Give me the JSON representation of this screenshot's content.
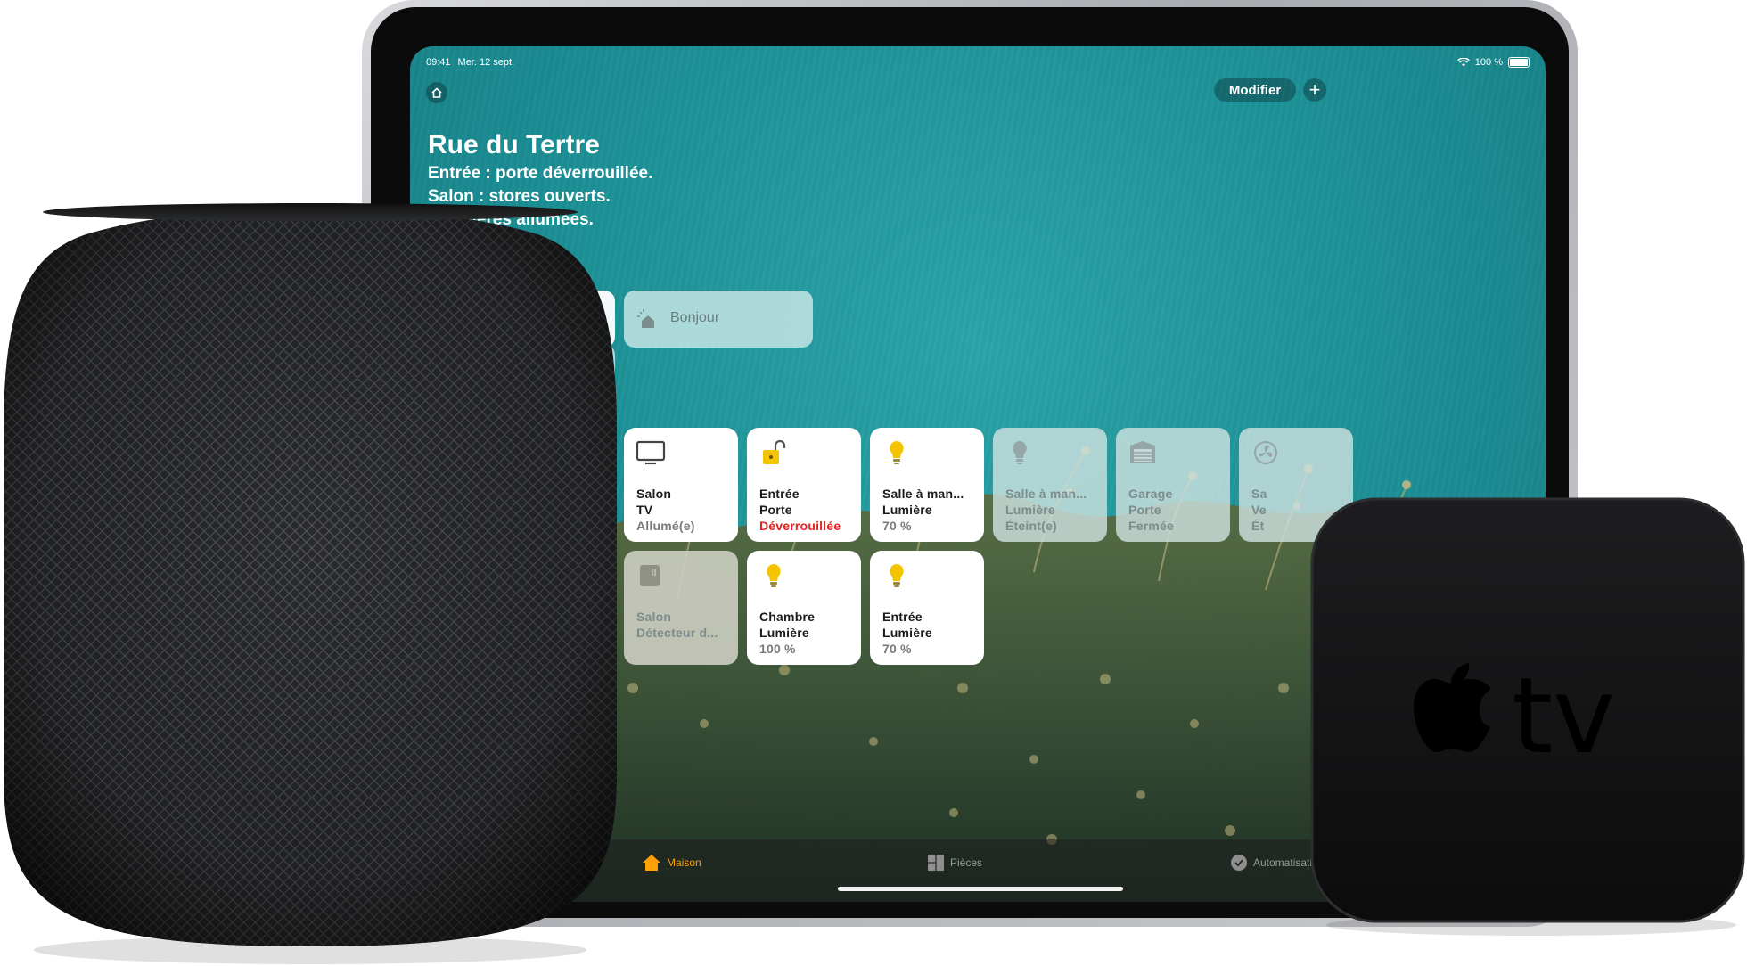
{
  "status_bar": {
    "time": "09:41",
    "date": "Mer. 12 sept.",
    "battery": "100 %"
  },
  "header": {
    "modifier_label": "Modifier",
    "plus_label": "+"
  },
  "home": {
    "title": "Rue du Tertre",
    "status": [
      "Entrée : porte déverrouillée.",
      "Salon : stores ouverts.",
      "4 lumières allumées."
    ]
  },
  "scenes": [
    {
      "label": "Bonjour"
    }
  ],
  "accessories": [
    {
      "room": "Salon",
      "name": "TV",
      "state": "Allumé(e)",
      "icon": "tv-icon"
    },
    {
      "room": "Entrée",
      "name": "Porte",
      "state": "Déverrouillée",
      "icon": "unlocked-lock-icon"
    },
    {
      "room": "Salle à man...",
      "name": "Lumière",
      "state": "70 %",
      "icon": "lightbulb-icon"
    },
    {
      "room": "Salle à man...",
      "name": "Lumière",
      "state": "Éteint(e)",
      "icon": "lightbulb-icon"
    },
    {
      "room": "Garage",
      "name": "Porte",
      "state": "Fermée",
      "icon": "garage-door-icon"
    },
    {
      "room": "Sa",
      "name": "Ve",
      "state": "Ét",
      "icon": "fan-icon"
    },
    {
      "room": "Salon",
      "name": "Détecteur d...",
      "state": "",
      "icon": "sensor-icon"
    },
    {
      "room": "Chambre",
      "name": "Lumière",
      "state": "100 %",
      "icon": "lightbulb-icon"
    },
    {
      "room": "Entrée",
      "name": "Lumière",
      "state": "70 %",
      "icon": "lightbulb-icon"
    }
  ],
  "tabs": [
    {
      "label": "Maison",
      "active": true
    },
    {
      "label": "Pièces",
      "active": false
    },
    {
      "label": "Automatisation",
      "active": false
    }
  ],
  "appletv": {
    "logo_text": "tv"
  },
  "colors": {
    "accent": "#ff9f0a",
    "alert": "#e4221e",
    "bulb": "#f5c400"
  }
}
